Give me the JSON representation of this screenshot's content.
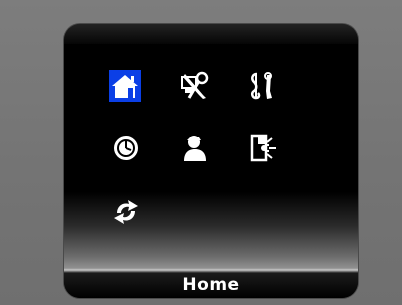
{
  "status_bar": {
    "label": "Home"
  },
  "menu": {
    "selected": "home",
    "items": [
      {
        "id": "home",
        "icon": "house-icon"
      },
      {
        "id": "tools",
        "icon": "tools-icon"
      },
      {
        "id": "music",
        "icon": "music-wrench-icon"
      },
      {
        "id": "clock",
        "icon": "clock-icon"
      },
      {
        "id": "user",
        "icon": "user-icon"
      },
      {
        "id": "display",
        "icon": "display-brightness-icon"
      },
      {
        "id": "refresh",
        "icon": "refresh-icon"
      }
    ]
  },
  "colors": {
    "background": "#777777",
    "screen": "#000000",
    "selection": "#0b3fe6",
    "icon": "#ffffff"
  }
}
